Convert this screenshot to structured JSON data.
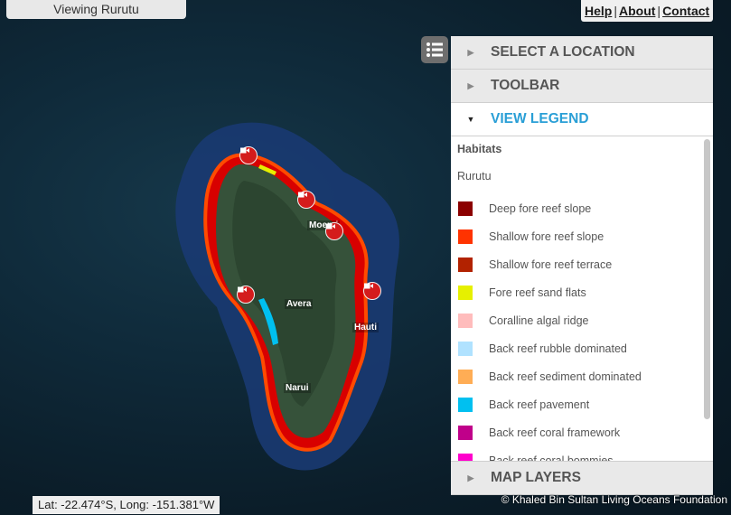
{
  "header": {
    "viewing": "Viewing Rurutu"
  },
  "links": {
    "help": "Help",
    "about": "About",
    "contact": "Contact"
  },
  "panel": {
    "select_location": "SELECT A LOCATION",
    "toolbar": "TOOLBAR",
    "view_legend": "VIEW LEGEND",
    "map_layers": "MAP LAYERS"
  },
  "legend": {
    "title": "Habitats",
    "location": "Rurutu",
    "items": [
      {
        "label": "Deep fore reef slope",
        "color": "#8b0000"
      },
      {
        "label": "Shallow fore reef slope",
        "color": "#ff3300"
      },
      {
        "label": "Shallow fore reef terrace",
        "color": "#b22200"
      },
      {
        "label": "Fore reef sand flats",
        "color": "#e6f000"
      },
      {
        "label": "Coralline algal ridge",
        "color": "#ffbcbc"
      },
      {
        "label": "Back reef rubble dominated",
        "color": "#b0e2ff"
      },
      {
        "label": "Back reef sediment dominated",
        "color": "#ffad55"
      },
      {
        "label": "Back reef pavement",
        "color": "#00c0f0"
      },
      {
        "label": "Back reef coral framework",
        "color": "#c0008a"
      },
      {
        "label": "Back reef coral bommies",
        "color": "#ff00cc"
      }
    ]
  },
  "map": {
    "places": [
      "Moerai",
      "Avera",
      "Hauti",
      "Narui"
    ],
    "camera_icon": "video-camera-icon"
  },
  "status": {
    "coordinates": "Lat: -22.474°S, Long: -151.381°W",
    "credit": "© Khaled Bin Sultan Living Oceans Foundation"
  }
}
